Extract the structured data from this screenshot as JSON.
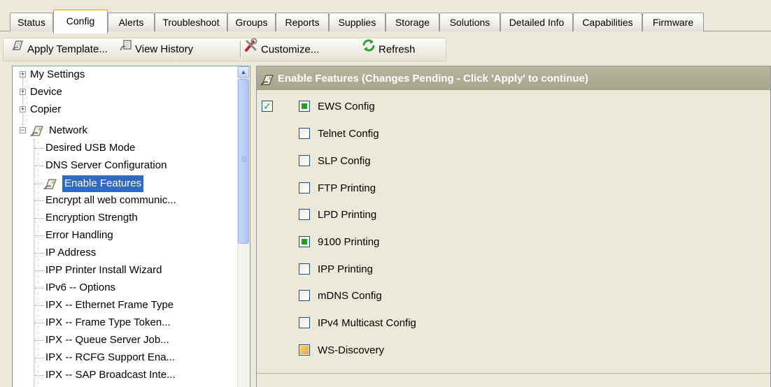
{
  "tabs": [
    "Status",
    "Config",
    "Alerts",
    "Troubleshoot",
    "Groups",
    "Reports",
    "Supplies",
    "Storage",
    "Solutions",
    "Detailed Info",
    "Capabilities",
    "Firmware"
  ],
  "active_tab": "Config",
  "toolbar": {
    "apply_template": "Apply Template...",
    "view_history": "View History",
    "customize": "Customize...",
    "refresh": "Refresh"
  },
  "tree": {
    "roots": [
      "My Settings",
      "Device",
      "Copier",
      "Network"
    ],
    "network_children": [
      "Desired USB Mode",
      "DNS Server Configuration",
      "Enable Features",
      "Encrypt all web communic...",
      "Encryption Strength",
      "Error Handling",
      "IP Address",
      "IPP Printer Install Wizard",
      "IPv6 -- Options",
      "IPX -- Ethernet Frame Type",
      "IPX -- Frame Type Token...",
      "IPX -- Queue Server Job...",
      "IPX -- RCFG Support Ena...",
      "IPX -- SAP Broadcast Inte..."
    ],
    "selected": "Enable Features"
  },
  "features": {
    "header": "Enable Features (Changes Pending - Click 'Apply' to continue)",
    "apply_checked": true,
    "options": [
      {
        "label": "EWS Config",
        "state": "enabled"
      },
      {
        "label": "Telnet Config",
        "state": "disabled"
      },
      {
        "label": "SLP Config",
        "state": "disabled"
      },
      {
        "label": "FTP Printing",
        "state": "disabled"
      },
      {
        "label": "LPD Printing",
        "state": "disabled"
      },
      {
        "label": "9100 Printing",
        "state": "enabled"
      },
      {
        "label": "IPP Printing",
        "state": "disabled"
      },
      {
        "label": "mDNS Config",
        "state": "disabled"
      },
      {
        "label": "IPv4 Multicast Config",
        "state": "disabled"
      },
      {
        "label": "WS-Discovery",
        "state": "partial"
      }
    ]
  },
  "colors": {
    "selection": "#316ac5",
    "header_bg": "#aca991",
    "enabled_fill": "#21a121",
    "active_tab_accent": "#ffc83c"
  }
}
